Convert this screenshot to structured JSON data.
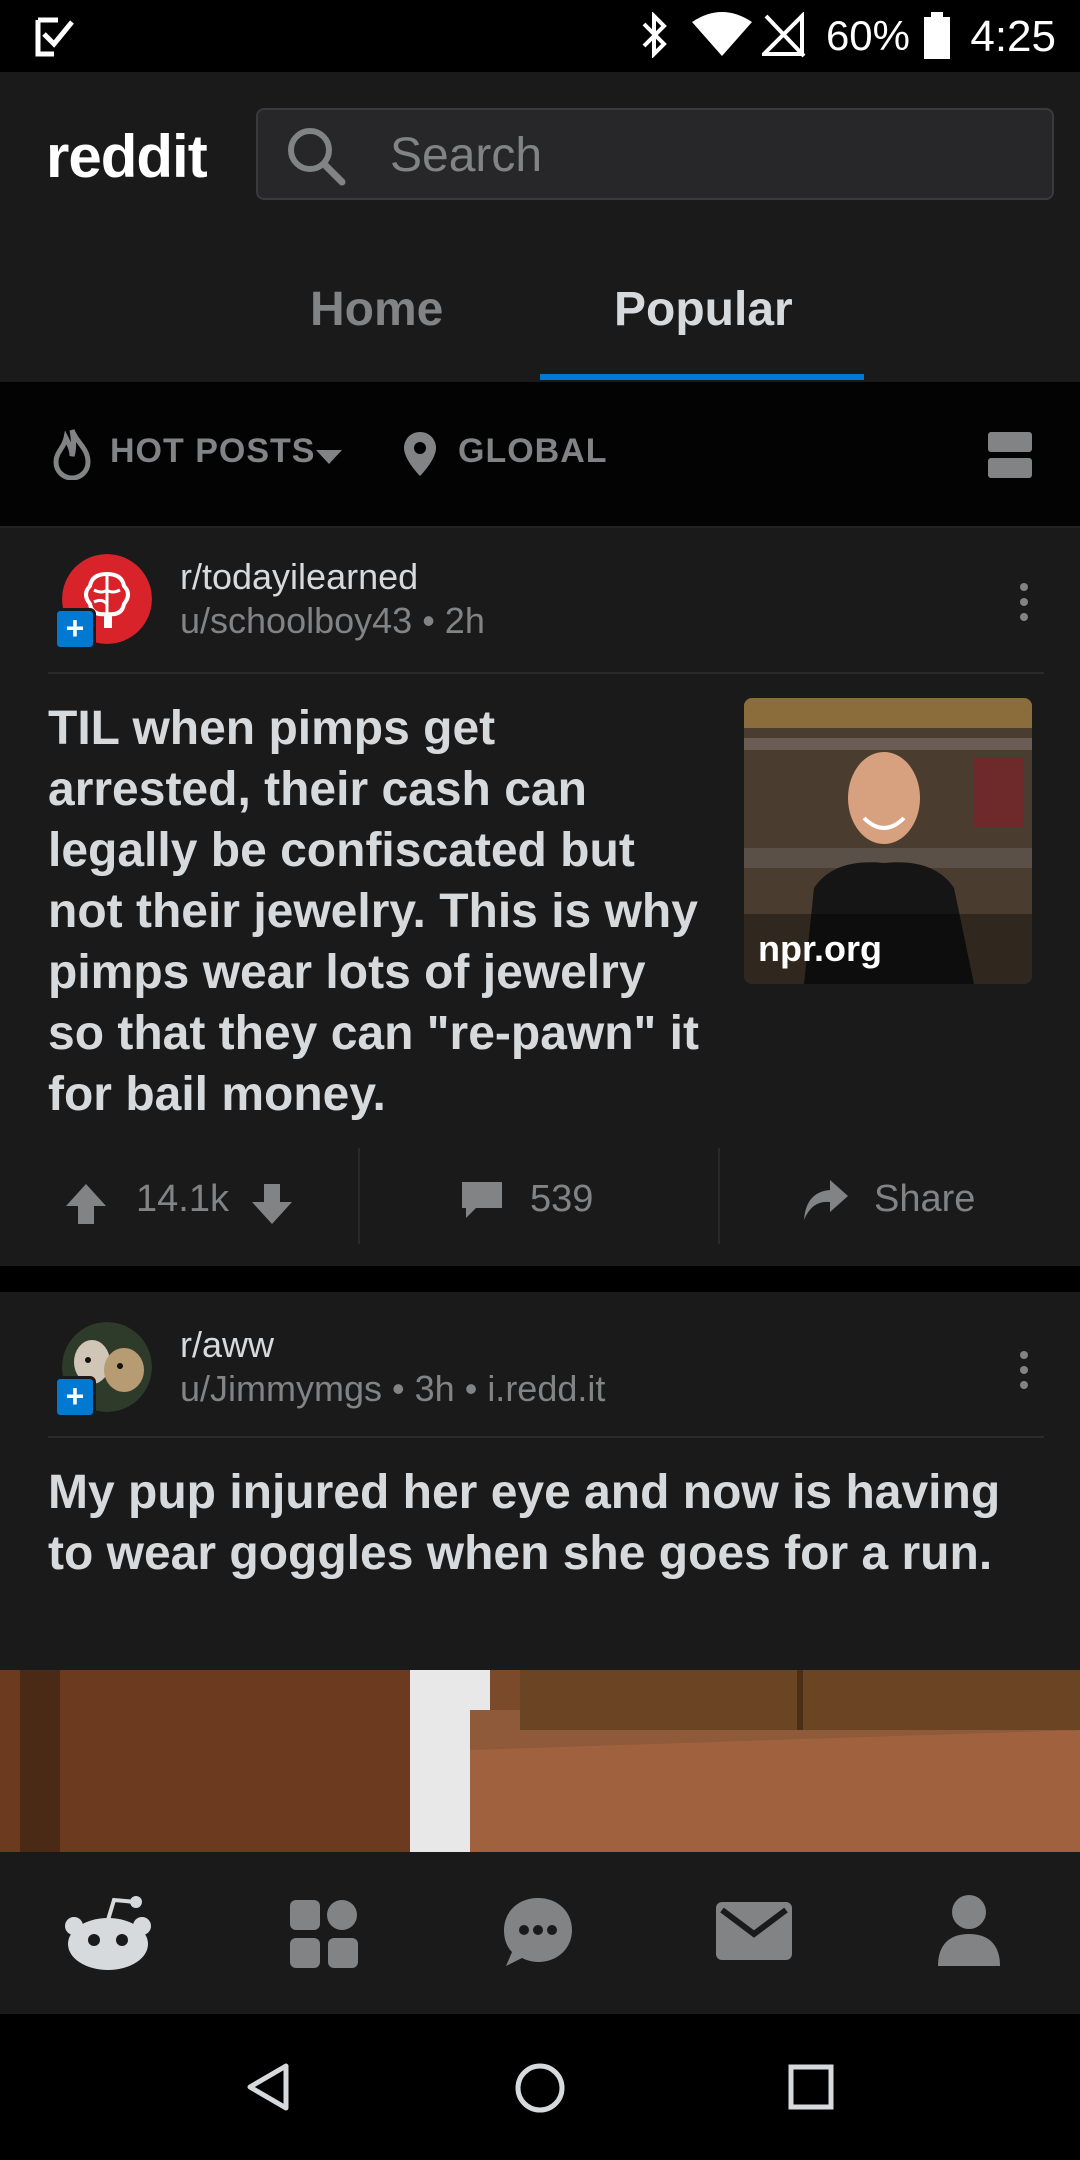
{
  "status_bar": {
    "battery": "60%",
    "time": "4:25"
  },
  "header": {
    "logo_text": "reddit",
    "search_placeholder": "Search",
    "tabs": [
      {
        "label": "Home"
      },
      {
        "label": "Popular"
      }
    ],
    "active_tab": "Popular"
  },
  "filters": {
    "sort": "HOT POSTS",
    "location": "GLOBAL"
  },
  "posts": [
    {
      "subreddit": "r/todayilearned",
      "user": "u/schoolboy43",
      "age": "2h",
      "title": "TIL when pimps get arrested, their cash can legally be confiscated but not their jewelry. This is why pimps wear lots of jewelry so that they can \"re-pawn\" it for bail money.",
      "thumbnail_domain": "npr.org",
      "score": "14.1k",
      "comments": "539",
      "share_label": "Share"
    },
    {
      "subreddit": "r/aww",
      "user": "u/Jimmymgs",
      "age": "3h",
      "domain": "i.redd.it",
      "title": "My pup injured her eye and now is having to wear goggles when she goes for a run."
    }
  ],
  "colors": {
    "accent": "#0079d3",
    "background": "#1a1a1b",
    "muted": "#818384",
    "logo_dot": "#ff4500"
  },
  "icons": {
    "bottom_nav": [
      "home-snoo-icon",
      "communities-icon",
      "chat-icon",
      "inbox-icon",
      "profile-icon"
    ],
    "system_nav": [
      "back-icon",
      "home-circle-icon",
      "recents-icon"
    ]
  }
}
